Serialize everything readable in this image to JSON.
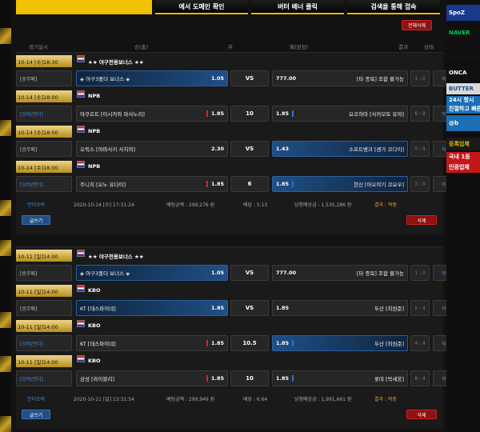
{
  "banner": [
    "",
    "에서 도메인 확인",
    "버터 배너 클릭",
    "검색을 통해 접속"
  ],
  "bulk_delete": "전체삭제",
  "columns": {
    "time": "경기일시",
    "home": "승(홈)",
    "draw": "무",
    "away": "패(원정)",
    "result": "결과",
    "status": "상태"
  },
  "groups": [
    {
      "leagues": [
        {
          "time": "10-14 [수]18:30",
          "league": "★★ 야구전용보너스 ★★",
          "type": "[승무패]",
          "type_style": "normal",
          "home": "◈ 야구3폴더 보너스 ◈",
          "home_odd": "1.05",
          "home_sel": true,
          "home_mark": false,
          "draw": "VS",
          "away": "[타 종목] 조합 불가능",
          "away_odd": "777.00",
          "away_sel": false,
          "away_mark": false,
          "score": "1 : 0",
          "status": "적중"
        },
        {
          "time": "10-14 [수]18:00",
          "league": "NPB",
          "type": "[오버/언더]",
          "type_style": "handicap",
          "home": "야쿠르트 [이시카와 마사노리]",
          "home_odd": "1.85",
          "home_sel": false,
          "home_mark": true,
          "draw": "10",
          "away": "요코하마 [사카모토 유야]",
          "away_odd": "1.85",
          "away_sel": false,
          "away_mark": true,
          "score": "6 : 9",
          "status": "적중"
        },
        {
          "time": "10-14 [수]18:00",
          "league": "NPB",
          "type": "[승무패]",
          "type_style": "normal",
          "home": "오릭스 [야마사키 사치야]",
          "home_odd": "2.30",
          "home_sel": false,
          "home_mark": false,
          "draw": "VS",
          "away": "소프트뱅크 [센가 코다이]",
          "away_odd": "1.43",
          "away_sel": true,
          "away_mark": false,
          "score": "0 : 4",
          "status": "적중"
        },
        {
          "time": "10-14 [수]18:00",
          "league": "NPB",
          "type": "[오버/언더]",
          "type_style": "handicap",
          "home": "주니치 [오노 유다이]",
          "home_odd": "1.85",
          "home_sel": false,
          "home_mark": true,
          "draw": "6",
          "away": "한신 [아오야기 코요우]",
          "away_odd": "1.85",
          "away_sel": true,
          "away_mark": true,
          "score": "3 : 0",
          "status": "적중"
        }
      ],
      "summary": {
        "label": "언더오버",
        "date": "2020-10-14 [수] 17:31:24",
        "bet": "베팅금액 : 299,276 원",
        "odds": "배당 : 5.13",
        "win": "당첨예상금 : 1,535,286 원",
        "result": "결과 : 적중"
      },
      "btn_write": "글쓰기",
      "btn_delete": "삭제"
    },
    {
      "leagues": [
        {
          "time": "10-11 [일]14:00",
          "league": "★★ 야구전용보너스 ★★",
          "type": "[승무패]",
          "type_style": "normal",
          "home": "◈ 야구3폴더 보너스 ◈",
          "home_odd": "1.05",
          "home_sel": true,
          "home_mark": false,
          "draw": "VS",
          "away": "[타 종목] 조합 불가능",
          "away_odd": "777.00",
          "away_sel": false,
          "away_mark": false,
          "score": "1 : 0",
          "status": "적중"
        },
        {
          "time": "10-11 [일]14:00",
          "league": "KBO",
          "type": "[승무패]",
          "type_style": "normal",
          "home": "KT [데스파이네]",
          "home_odd": "1.85",
          "home_sel": true,
          "home_mark": false,
          "draw": "VS",
          "away": "두산 [최원준]",
          "away_odd": "1.85",
          "away_sel": false,
          "away_mark": false,
          "score": "5 : 4",
          "status": "적중"
        },
        {
          "time": "10-11 [일]14:00",
          "league": "KBO",
          "type": "[오버/언더]",
          "type_style": "handicap",
          "home": "KT [데스파이네]",
          "home_odd": "1.85",
          "home_sel": false,
          "home_mark": true,
          "draw": "10.5",
          "away": "두산 [최원준]",
          "away_odd": "1.85",
          "away_sel": true,
          "away_mark": true,
          "score": "4 : 4",
          "status": "적중"
        },
        {
          "time": "10-11 [일]14:00",
          "league": "KBO",
          "type": "[오버/언더]",
          "type_style": "handicap",
          "home": "삼성 [라이블리]",
          "home_odd": "1.85",
          "home_sel": false,
          "home_mark": true,
          "draw": "10",
          "away": "롯데 [박세웅]",
          "away_odd": "1.85",
          "away_sel": false,
          "away_mark": true,
          "score": "8 : 4",
          "status": "적중"
        }
      ],
      "summary": {
        "label": "언더오버",
        "date": "2020-10-11 [일] 13:31:54",
        "bet": "베팅금액 : 299,949 원",
        "odds": "배당 : 6.64",
        "win": "당첨예상금 : 1,991,661 원",
        "result": "결과 : 적중"
      },
      "btn_write": "글쓰기",
      "btn_delete": "삭제"
    }
  ],
  "sidebar": {
    "items": [
      {
        "text": "SpoZ",
        "bg": "#1a3a8c",
        "color": "#ffffff"
      },
      {
        "text": "NAVER",
        "bg": "#111111",
        "color": "#03c75a"
      },
      {
        "text": "",
        "bg": "#111111",
        "color": "#e02222"
      },
      {
        "text": "ONCA",
        "bg": "#101010",
        "color": "#ffffff"
      },
      {
        "text": "BUTTER",
        "bg": "#d9d9d9",
        "color": "#1f4f86"
      },
      {
        "text": "24시 항시",
        "bg": "#1d6fb5",
        "color": "#ffffff"
      },
      {
        "text": "친절하고 빠른",
        "bg": "#1d6fb5",
        "color": "#ffffff"
      },
      {
        "text": "@b",
        "bg": "#1d6fb5",
        "color": "#ffffff"
      },
      {
        "text": "등록업체",
        "bg": "#1a1a1a",
        "color": "#e6b800"
      },
      {
        "text": "국내 1등",
        "bg": "#c21818",
        "color": "#ffffff"
      },
      {
        "text": "인증업체",
        "bg": "#c21818",
        "color": "#ffffff"
      }
    ]
  }
}
